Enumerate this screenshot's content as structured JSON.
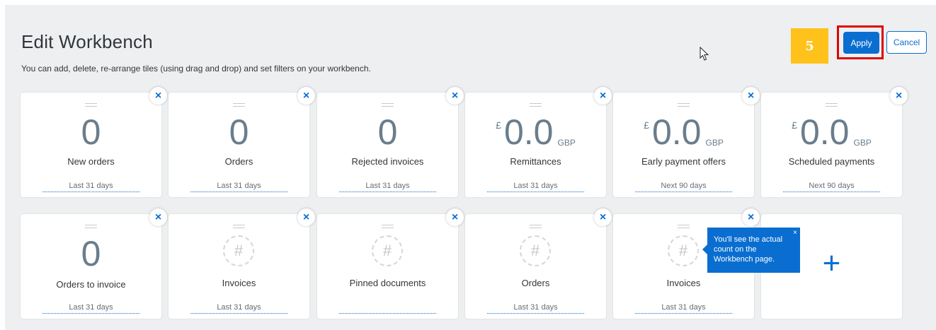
{
  "header": {
    "title": "Edit Workbench",
    "subtitle": "You can add, delete, re-arrange tiles (using drag and drop) and set filters on your workbench.",
    "step_number": "5",
    "apply_label": "Apply",
    "cancel_label": "Cancel"
  },
  "tiles": [
    {
      "value": "0",
      "label": "New orders",
      "period": "Last 31 days"
    },
    {
      "value": "0",
      "label": "Orders",
      "period": "Last 31 days"
    },
    {
      "value": "0",
      "label": "Rejected invoices",
      "period": "Last 31 days"
    },
    {
      "currency": "£",
      "value": "0.0",
      "code": "GBP",
      "label": "Remittances",
      "period": "Last 31 days"
    },
    {
      "currency": "£",
      "value": "0.0",
      "code": "GBP",
      "label": "Early payment offers",
      "period": "Next 90 days"
    },
    {
      "currency": "£",
      "value": "0.0",
      "code": "GBP",
      "label": "Scheduled payments",
      "period": "Next 90 days"
    },
    {
      "value": "0",
      "label": "Orders to invoice",
      "period": "Last 31 days"
    },
    {
      "placeholder": "#",
      "label": "Invoices",
      "period": "Last 31 days"
    },
    {
      "placeholder": "#",
      "label": "Pinned documents",
      "period": ""
    },
    {
      "placeholder": "#",
      "label": "Orders",
      "period": "Last 31 days"
    },
    {
      "placeholder": "#",
      "label": "Invoices",
      "period": "Last 31 days"
    }
  ],
  "add_tile": {
    "symbol": "+"
  },
  "remove_symbol": "×",
  "tooltip": {
    "text": "You'll see the actual count on the Workbench page.",
    "close_symbol": "×"
  },
  "colors": {
    "accent": "#0a6ed1",
    "step_badge": "#ffc21a",
    "highlight": "#e00000",
    "kpi_number": "#6a7d8c"
  }
}
